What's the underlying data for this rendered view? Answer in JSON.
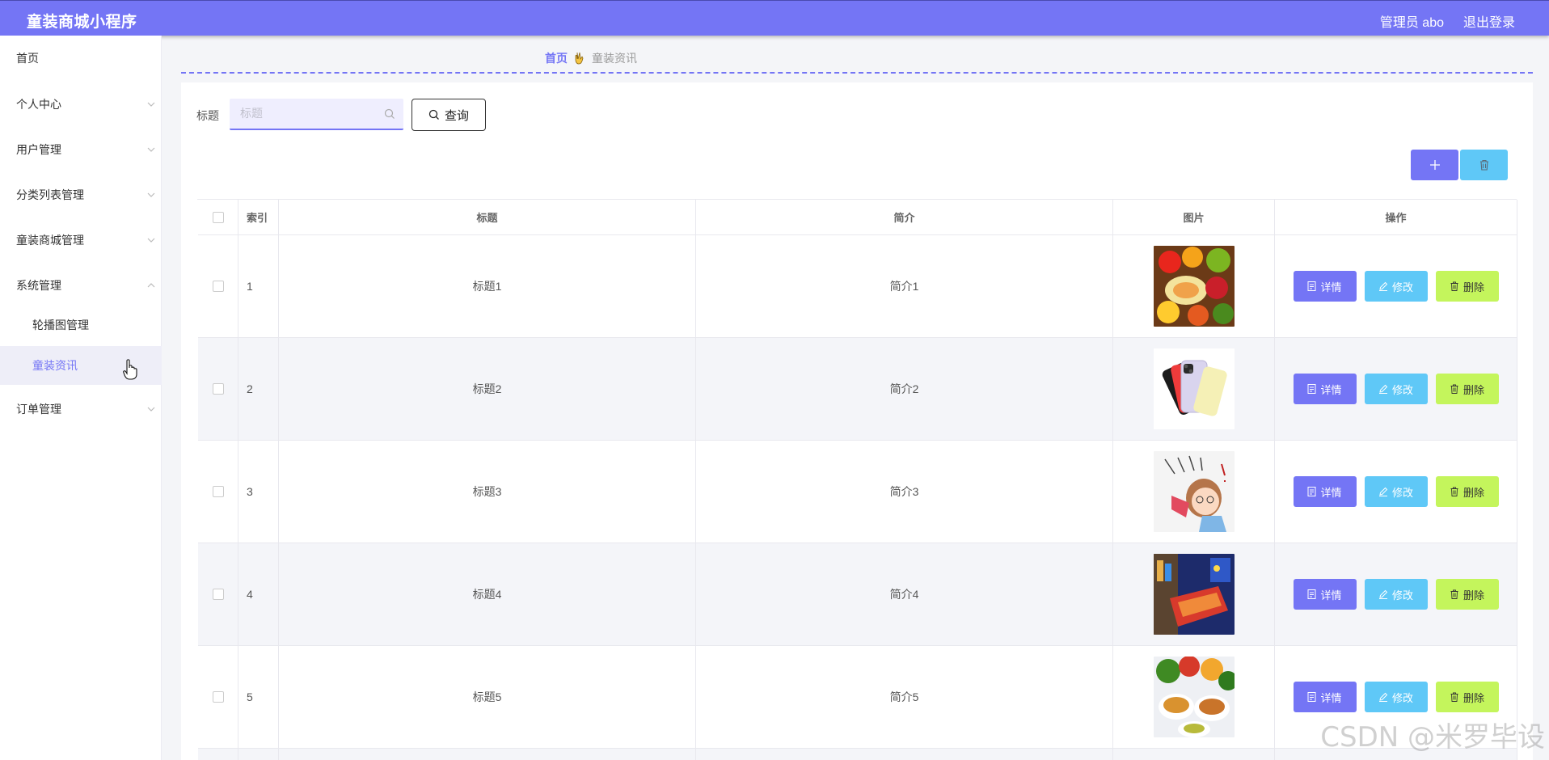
{
  "header": {
    "title": "童装商城小程序",
    "admin": "管理员 abo",
    "logout": "退出登录"
  },
  "sidebar": {
    "items": [
      {
        "label": "首页"
      },
      {
        "label": "个人中心"
      },
      {
        "label": "用户管理"
      },
      {
        "label": "分类列表管理"
      },
      {
        "label": "童装商城管理"
      },
      {
        "label": "系统管理"
      },
      {
        "label": "轮播图管理"
      },
      {
        "label": "童装资讯"
      },
      {
        "label": "订单管理"
      }
    ]
  },
  "breadcrumb": {
    "home": "首页",
    "current": "童装资讯"
  },
  "search": {
    "label": "标题",
    "placeholder": "标题",
    "button": "查询"
  },
  "table": {
    "headers": {
      "index": "索引",
      "title": "标题",
      "intro": "简介",
      "image": "图片",
      "ops": "操作"
    },
    "rows": [
      {
        "index": "1",
        "title": "标题1",
        "intro": "简介1"
      },
      {
        "index": "2",
        "title": "标题2",
        "intro": "简介2"
      },
      {
        "index": "3",
        "title": "标题3",
        "intro": "简介3"
      },
      {
        "index": "4",
        "title": "标题4",
        "intro": "简介4"
      },
      {
        "index": "5",
        "title": "标题5",
        "intro": "简介5"
      }
    ],
    "ops": {
      "detail": "详情",
      "edit": "修改",
      "delete": "删除"
    }
  },
  "watermark": "CSDN @米罗毕设",
  "colors": {
    "accent": "#7475f5",
    "cyan": "#5fc8f7",
    "lime": "#c4f55c"
  }
}
